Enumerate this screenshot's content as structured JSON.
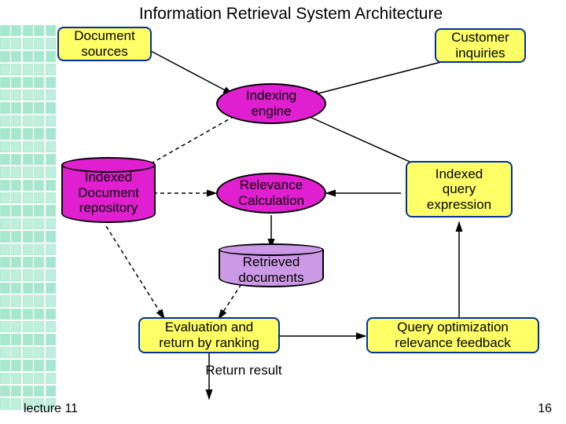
{
  "title": "Information Retrieval System Architecture",
  "nodes": {
    "doc_sources": "Document\nsources",
    "customer_inquiries": "Customer\ninquiries",
    "indexing_engine": "Indexing\nengine",
    "indexed_doc_repo": "Indexed\nDocument\nrepository",
    "relevance_calc": "Relevance\nCalculation",
    "indexed_query": "Indexed\nquery\nexpression",
    "retrieved_docs": "Retrieved\ndocuments",
    "eval_ranking": "Evaluation and\nreturn by ranking",
    "query_feedback": "Query optimization\nrelevance feedback",
    "return_result": "Return result"
  },
  "footer": {
    "lecture": "lecture 11",
    "page": "16"
  },
  "colors": {
    "yellow": "#ffff66",
    "magenta": "#e020d0",
    "purple": "#cc99e6",
    "border_blue": "#003399",
    "grid": "#bfeedd"
  }
}
